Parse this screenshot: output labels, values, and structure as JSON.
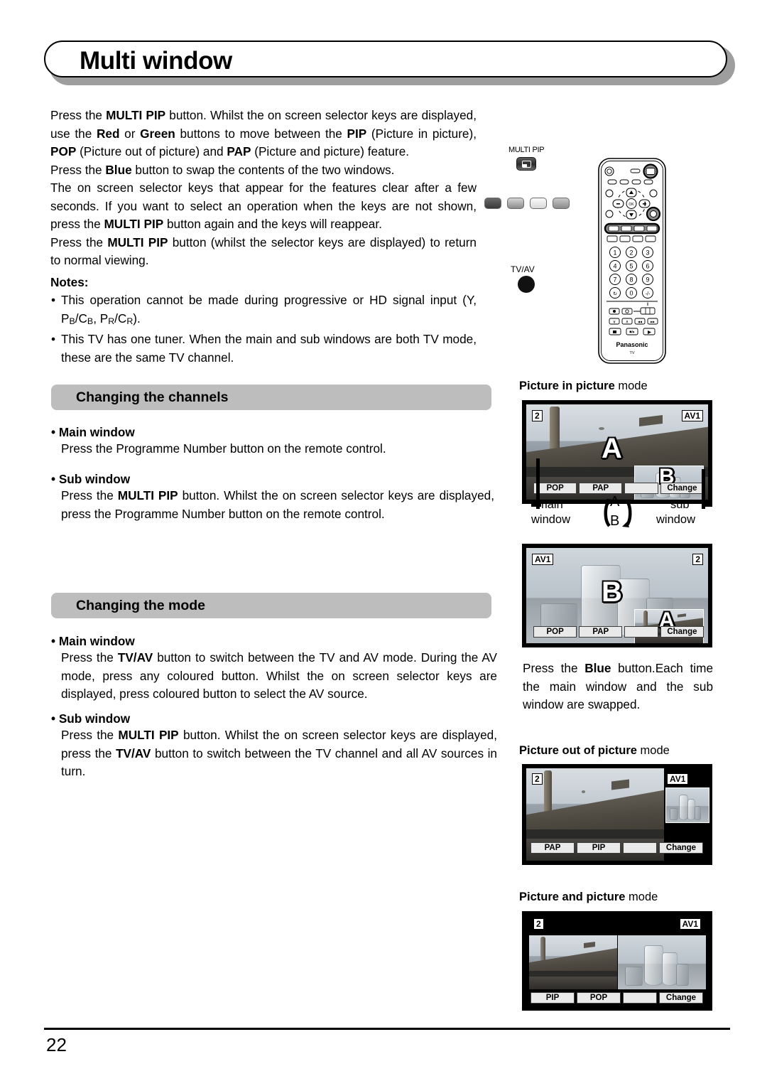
{
  "page": {
    "title": "Multi window",
    "number": "22"
  },
  "intro": {
    "p1_a": "Press the ",
    "p1_b": "MULTI PIP",
    "p1_c": " button. Whilst the on screen selector keys are displayed, use the ",
    "p1_d": "Red",
    "p1_e": " or ",
    "p1_f": "Green",
    "p1_g": " buttons to move between the ",
    "p1_h": "PIP",
    "p1_i": " (Picture in picture), ",
    "p1_j": "POP",
    "p1_k": " (Picture out of picture) and ",
    "p1_l": "PAP",
    "p1_m": " (Picture and picture) feature.",
    "p2_a": "Press the ",
    "p2_b": "Blue",
    "p2_c": " button to swap the contents of the two windows.",
    "p3_a": "The on screen selector keys that appear for the features clear after a few seconds. If you want to select an operation when the keys are not shown, press the ",
    "p3_b": "MULTI PIP",
    "p3_c": " button again and the keys will reappear.",
    "p4_a": "Press the ",
    "p4_b": "MULTI PIP",
    "p4_c": " button (whilst the selector keys are displayed) to return to normal viewing."
  },
  "notes": {
    "label": "Notes:",
    "bullet": "•",
    "item1_a": "This operation cannot be made during progressive or HD signal input (Y, P",
    "item1_sub1": "B",
    "item1_b": "/C",
    "item1_sub2": "B",
    "item1_c": ", P",
    "item1_sub3": "R",
    "item1_d": "/C",
    "item1_sub4": "R",
    "item1_e": ").",
    "item2": "This TV has one tuner. When the main and sub windows are both TV mode, these are the same TV channel."
  },
  "remote_callouts": {
    "multi_pip_label": "MULTI PIP",
    "tvav_label": "TV/AV",
    "colour_keys": [
      "red-key",
      "green-key",
      "yellow-key",
      "blue-key"
    ],
    "brand": "Panasonic",
    "brand_sub": "TV"
  },
  "section_channels": {
    "heading": "Changing the channels",
    "main_head_bullet": "•",
    "main_head": "Main window",
    "main_text": "Press the Programme Number button on the remote control.",
    "sub_head": "Sub window",
    "sub_text_a": "Press the ",
    "sub_text_b": "MULTI PIP",
    "sub_text_c": " button. Whilst the on screen selector keys are displayed, press the Programme Number button on the remote control."
  },
  "section_mode": {
    "heading": "Changing the mode",
    "main_head": "Main window",
    "main_text_a": "Press the ",
    "main_text_b": "TV/AV",
    "main_text_c": " button to switch between the TV and AV mode. During the AV mode, press any coloured button. Whilst the on screen selector keys are displayed, press coloured button to select the AV source.",
    "sub_head": "Sub window",
    "sub_text_a": "Press the ",
    "sub_text_b": "MULTI PIP",
    "sub_text_c": " button. Whilst the on screen selector keys are displayed, press the ",
    "sub_text_d": "TV/AV",
    "sub_text_e": " button to switch between the TV channel and all AV sources in turn."
  },
  "figures": {
    "pip": {
      "caption_bold": "Picture in picture",
      "caption_light": " mode",
      "main_tag": "2",
      "sub_tag": "AV1",
      "main_letter": "A",
      "sub_letter": "B",
      "keys": [
        "POP",
        "PAP",
        "",
        "Change"
      ],
      "main_window_label_line1": "main",
      "main_window_label_line2": "window",
      "sub_window_label_line1": "sub",
      "sub_window_label_line2": "window",
      "swap_top": "A",
      "swap_bottom": "B"
    },
    "pip_swapped": {
      "main_tag": "AV1",
      "sub_tag": "2",
      "main_letter": "B",
      "sub_letter": "A",
      "keys": [
        "POP",
        "PAP",
        "",
        "Change"
      ],
      "note_a": "Press the ",
      "note_b": "Blue",
      "note_c": " button.",
      "note_d": "Each time the main window and the sub window are swapped."
    },
    "pop": {
      "caption_bold": "Picture out of picture",
      "caption_light": " mode",
      "main_tag": "2",
      "sub_tag": "AV1",
      "keys": [
        "PAP",
        "PIP",
        "",
        "Change"
      ]
    },
    "pap": {
      "caption_bold": "Picture and picture",
      "caption_light": " mode",
      "main_tag": "2",
      "sub_tag": "AV1",
      "keys": [
        "PIP",
        "POP",
        "",
        "Change"
      ]
    }
  },
  "colors": {
    "section_bar": "#bdbdbd",
    "title_shadow": "#9e9e9e",
    "osd_key_bg": "#e9e9e9",
    "ink": "#000000"
  }
}
